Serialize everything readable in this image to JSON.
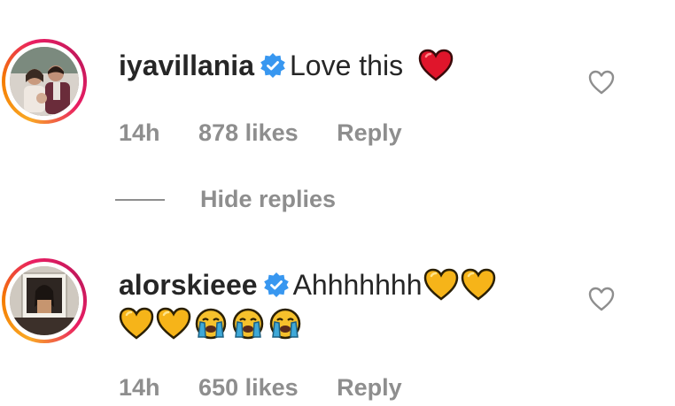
{
  "comments": [
    {
      "username": "iyavillania",
      "text": "Love this",
      "emojis": [
        "red-heart"
      ],
      "time": "14h",
      "likes": "878 likes",
      "reply": "Reply"
    },
    {
      "username": "alorskieee",
      "text": "Ahhhhhhh",
      "emojis_line1": [
        "yellow-heart",
        "yellow-heart"
      ],
      "emojis_line2": [
        "yellow-heart",
        "yellow-heart",
        "loudly-crying-face",
        "loudly-crying-face",
        "loudly-crying-face"
      ],
      "time": "14h",
      "likes": "650 likes",
      "reply": "Reply"
    }
  ],
  "thread": {
    "hide_replies": "Hide replies"
  },
  "colors": {
    "text": "#262626",
    "meta": "#8e8e8e",
    "verified": "#3897f0",
    "red_heart": "#e0152b",
    "yellow_heart": "#f6b419"
  }
}
